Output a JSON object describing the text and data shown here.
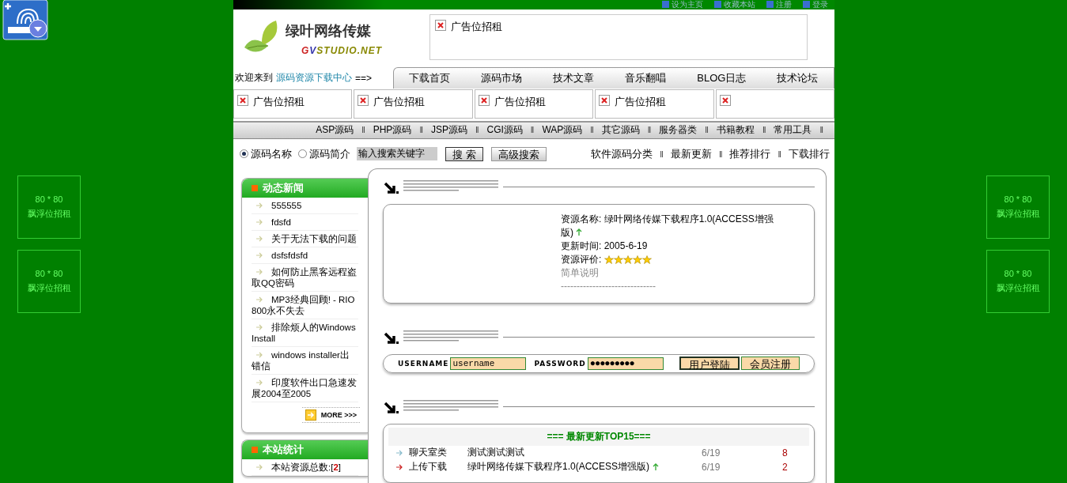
{
  "top_links": [
    "设为主页",
    "收藏本站",
    "注册",
    "登录"
  ],
  "logo": {
    "title": "绿叶网络传媒",
    "subtitle": "GVSTUDIO.NET"
  },
  "header_ad": {
    "text": "广告位招租"
  },
  "welcome": {
    "text": "欢迎来到",
    "link": "源码资源下载中心",
    "arrow": "==>"
  },
  "nav_tabs": [
    "下载首页",
    "源码市场",
    "技术文章",
    "音乐翻唱",
    "BLOG日志",
    "技术论坛"
  ],
  "ads": [
    {
      "kind": "text",
      "text": "广告位招租"
    },
    {
      "kind": "text",
      "text": "广告位招租"
    },
    {
      "kind": "text",
      "text": "广告位招租"
    },
    {
      "kind": "text",
      "text": "广告位招租"
    },
    {
      "kind": "image"
    }
  ],
  "categories": [
    {
      "label": "ASP源码",
      "separator": "‖"
    },
    {
      "label": "PHP源码",
      "separator": "‖"
    },
    {
      "label": "JSP源码",
      "separator": "‖"
    },
    {
      "label": "CGI源码",
      "separator": "‖"
    },
    {
      "label": "WAP源码",
      "separator": "‖"
    },
    {
      "label": "其它源码",
      "separator": "‖"
    },
    {
      "label": "服务器类",
      "separator": "‖"
    },
    {
      "label": "书籍教程",
      "separator": "‖"
    },
    {
      "label": "常用工具",
      "separator": "‖"
    }
  ],
  "search": {
    "options": [
      {
        "label": "源码名称",
        "selected": true
      },
      {
        "label": "源码简介",
        "selected": false
      }
    ],
    "value": "输入搜索关键字",
    "buttons": [
      "搜 索",
      "高级搜索"
    ]
  },
  "quick_links": [
    {
      "label": "软件源码分类",
      "separator": "‖"
    },
    {
      "label": "最新更新",
      "separator": "‖"
    },
    {
      "label": "推荐排行",
      "separator": "‖"
    },
    {
      "label": "下载排行"
    }
  ],
  "news": {
    "title": "动态新闻",
    "items": [
      "555555",
      "fdsfd",
      "关于无法下载的问题",
      "dsfsfdsfd",
      "如何防止黑客远程盗取QQ密码",
      "MP3经典回顾! - RIO 800永不失去",
      "排除烦人的Windows Install",
      "windows installer出错信",
      "印度软件出口急速发展2004至2005"
    ],
    "more": "MORE",
    "more_arrows": ">>>"
  },
  "stats": {
    "title": "本站统计",
    "items": [
      {
        "prefix": "本站资源总数:[",
        "count": "2",
        "suffix": "]"
      }
    ]
  },
  "featured": {
    "name_label": "资源名称:",
    "name": "绿叶网络传媒下载程序1.0(ACCESS增强版)",
    "updated_label": "更新时间:",
    "updated": "2005-6-19",
    "rating_label": "资源评价:",
    "stars": 5,
    "desc_label": "简单说明",
    "rule": "------------------------------"
  },
  "login": {
    "username_label": "USERNAME",
    "username": "username",
    "password_label": "PASSWORD",
    "password": "●●●●●●●●●",
    "buttons": [
      "用户登陆",
      "会员注册"
    ]
  },
  "top15": {
    "title": "=== 最新更新TOP15===",
    "rows": [
      {
        "category": "聊天室类",
        "name": "测试测试测试",
        "new": false,
        "date": "6/19",
        "count": "8",
        "color": "#88bbcc"
      },
      {
        "category": "上传下载",
        "name": "绿叶网络传媒下载程序1.0(ACCESS增强版)",
        "new": true,
        "date": "6/19",
        "count": "2",
        "color": "#cc2222"
      }
    ]
  },
  "float_ads": [
    {
      "size": "80 * 80",
      "text": "飘浮位招租"
    },
    {
      "size": "80 * 80",
      "text": "飘浮位招租"
    },
    {
      "size": "80 * 80",
      "text": "飘浮位招租"
    },
    {
      "size": "80 * 80",
      "text": "飘浮位招租"
    }
  ]
}
